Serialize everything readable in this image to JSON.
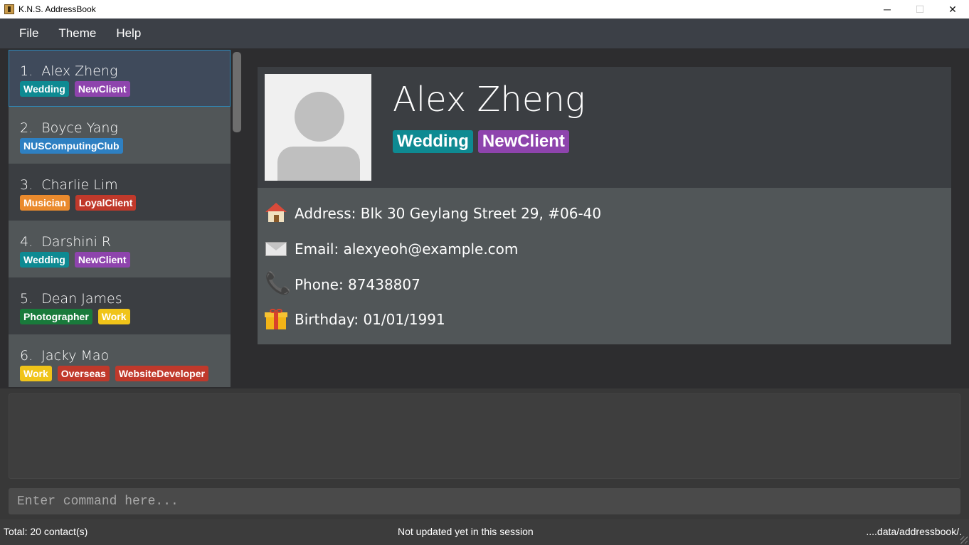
{
  "window": {
    "title": "K.N.S. AddressBook",
    "minimize_glyph": "─",
    "maximize_glyph": "☐",
    "close_glyph": "✕"
  },
  "menu": [
    "File",
    "Theme",
    "Help"
  ],
  "tag_colors": {
    "Wedding": "#0e8a92",
    "NewClient": "#8e44ad",
    "NUSComputingClub": "#2e80c2",
    "Musician": "#ea8a2d",
    "LoyalClient": "#c0392b",
    "Photographer": "#197a3b",
    "Work": "#f0c419",
    "Overseas": "#c0392b",
    "WebsiteDeveloper": "#c0392b"
  },
  "persons": [
    {
      "index": "1.",
      "name": "Alex Zheng",
      "tags": [
        "Wedding",
        "NewClient"
      ]
    },
    {
      "index": "2.",
      "name": "Boyce Yang",
      "tags": [
        "NUSComputingClub"
      ]
    },
    {
      "index": "3.",
      "name": "Charlie Lim",
      "tags": [
        "Musician",
        "LoyalClient"
      ]
    },
    {
      "index": "4.",
      "name": "Darshini R",
      "tags": [
        "Wedding",
        "NewClient"
      ]
    },
    {
      "index": "5.",
      "name": "Dean James",
      "tags": [
        "Photographer",
        "Work"
      ]
    },
    {
      "index": "6.",
      "name": "Jacky Mao",
      "tags": [
        "Work",
        "Overseas",
        "WebsiteDeveloper"
      ]
    }
  ],
  "detail": {
    "name": "Alex Zheng",
    "tags": [
      "Wedding",
      "NewClient"
    ],
    "address": "Address: Blk 30 Geylang Street 29, #06-40",
    "email": "Email: alexyeoh@example.com",
    "phone": "Phone: 87438807",
    "birthday": "Birthday: 01/01/1991",
    "phone_glyph": "📞"
  },
  "command": {
    "placeholder": "Enter command here...",
    "value": ""
  },
  "status": {
    "total": "Total: 20 contact(s)",
    "sync": "Not updated yet in this session",
    "path": "....data/addressbook/."
  }
}
